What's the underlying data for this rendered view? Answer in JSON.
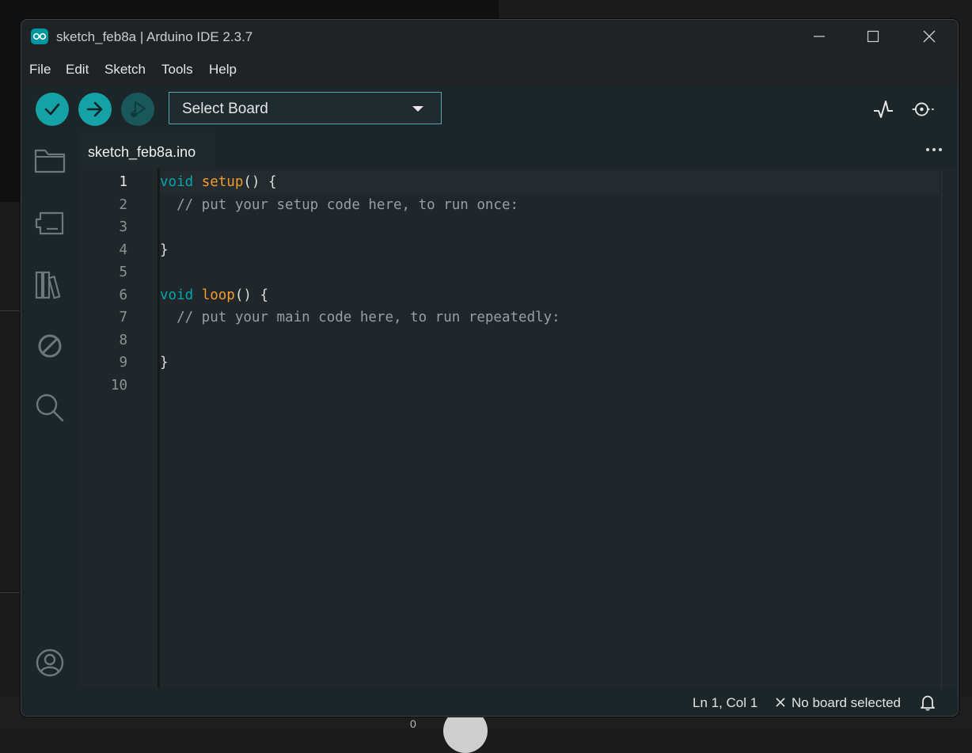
{
  "window": {
    "title": "sketch_feb8a | Arduino IDE 2.3.7"
  },
  "menu": {
    "file": "File",
    "edit": "Edit",
    "sketch": "Sketch",
    "tools": "Tools",
    "help": "Help"
  },
  "toolbar": {
    "board_select": "Select Board"
  },
  "tab": {
    "filename": "sketch_feb8a.ino"
  },
  "editor": {
    "line_numbers": [
      "1",
      "2",
      "3",
      "4",
      "5",
      "6",
      "7",
      "8",
      "9",
      "10"
    ],
    "active_line": 1
  },
  "code": {
    "l1_kw": "void",
    "l1_fn": "setup",
    "l1_rest": "() {",
    "l2_comment": "  // put your setup code here, to run once:",
    "l4": "}",
    "l6_kw": "void",
    "l6_fn": "loop",
    "l6_rest": "() {",
    "l7_comment": "  // put your main code here, to run repeatedly:",
    "l9": "}"
  },
  "status": {
    "position": "Ln 1, Col 1",
    "board": "No board selected"
  },
  "desktop": {
    "dock_digit": "0"
  },
  "colors": {
    "accent": "#00979c",
    "keyword": "#00a7ae",
    "function": "#f39c2c",
    "comment": "#95a0a4",
    "editor_bg": "#202629",
    "toolbar_bg": "#1c2629"
  },
  "icons": {
    "app": "arduino-infinity-icon",
    "verify": "checkmark-icon",
    "upload": "arrow-right-icon",
    "debug": "debug-play-icon",
    "serial_plotter": "pulse-icon",
    "serial_monitor": "magnifier-dot-icon",
    "sketchbook": "folder-icon",
    "boards_manager": "board-icon",
    "library_manager": "library-icon",
    "debugger": "no-entry-icon",
    "search": "search-icon",
    "account": "user-icon",
    "more": "ellipsis-icon",
    "notifications": "bell-icon"
  }
}
